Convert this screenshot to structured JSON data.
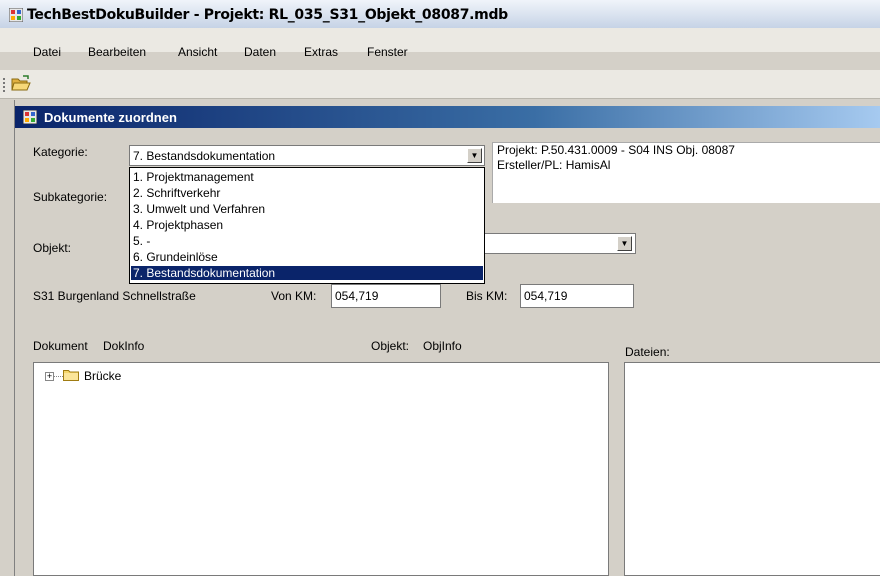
{
  "window": {
    "title": "TechBestDokuBuilder - Projekt: RL_035_S31_Objekt_08087.mdb"
  },
  "menu": [
    "Datei",
    "Bearbeiten",
    "Ansicht",
    "Daten",
    "Extras",
    "Fenster"
  ],
  "child": {
    "title": "Dokumente zuordnen"
  },
  "form": {
    "kategorie_label": "Kategorie:",
    "kategorie_value": "7. Bestandsdokumentation",
    "kategorie_options": [
      "1. Projektmanagement",
      "2. Schriftverkehr",
      "3. Umwelt und Verfahren",
      "4. Projektphasen",
      "5. -",
      "6. Grundeinlöse",
      "7. Bestandsdokumentation"
    ],
    "subkategorie_label": "Subkategorie:",
    "objekt_label": "Objekt:",
    "road_label": "S31 Burgenland Schnellstraße",
    "von_km_label": "Von KM:",
    "von_km_value": "054,719",
    "bis_km_label": "Bis KM:",
    "bis_km_value": "054,719"
  },
  "project_info": {
    "line1": "Projekt: P.50.431.0009 - S04 INS Obj. 08087",
    "line2": "Ersteller/PL: HamisAl"
  },
  "documents": {
    "header_dokument": "Dokument",
    "header_dokinfo": "DokInfo",
    "header_objekt": "Objekt:",
    "header_objinfo": "ObjInfo",
    "tree": [
      {
        "label": "Brücke",
        "expander": "+"
      }
    ]
  },
  "files": {
    "header": "Dateien:"
  },
  "icons": {
    "app_icon": "app-icon",
    "toolbar_open": "open-folder-icon",
    "dropdown_arrow": "▼"
  },
  "colors": {
    "selection": "#0a246a",
    "child_title_start": "#0a246a",
    "child_title_end": "#a6caf0"
  }
}
